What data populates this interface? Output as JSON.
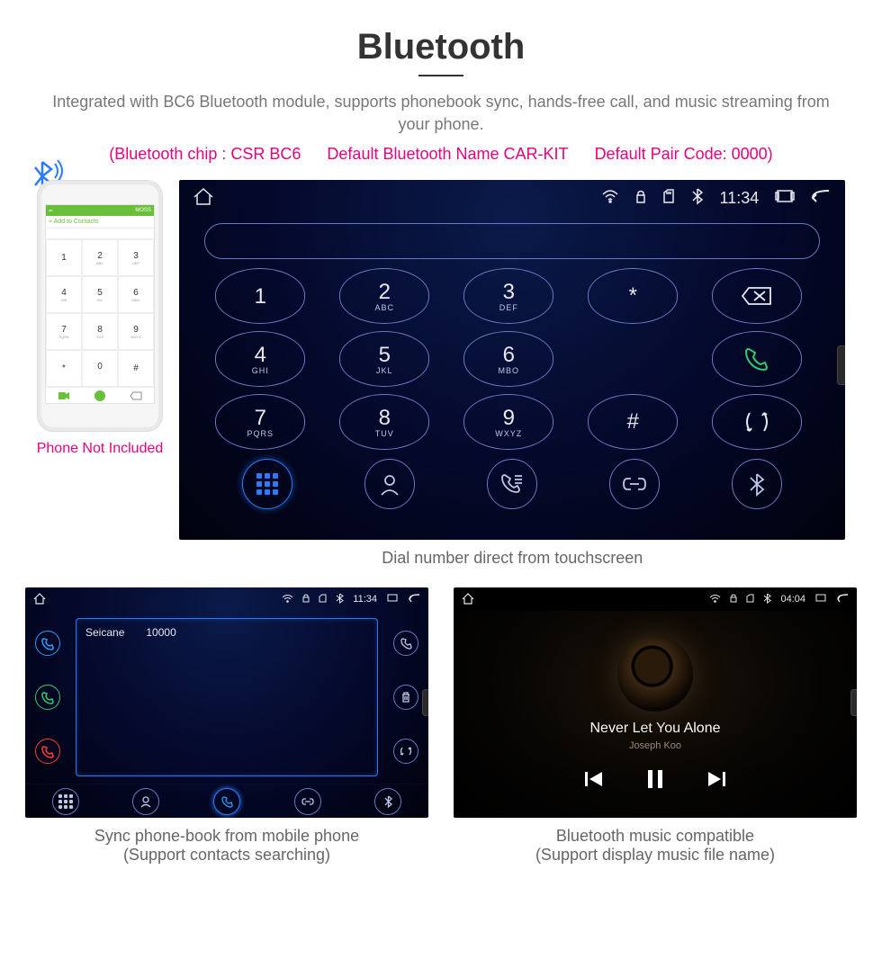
{
  "header": {
    "title": "Bluetooth"
  },
  "description": "Integrated with BC6 Bluetooth module, supports phonebook sync, hands-free call, and music streaming from your phone.",
  "specs": {
    "chip": "(Bluetooth chip : CSR BC6",
    "name": "Default Bluetooth Name CAR-KIT",
    "code": "Default Pair Code: 0000)"
  },
  "phone_mock": {
    "top_label": "MOSS",
    "add_label": "+ Add to Contacts",
    "caption": "Phone Not Included",
    "keys": [
      "1",
      "2",
      "3",
      "4",
      "5",
      "6",
      "7",
      "8",
      "9",
      "*",
      "0",
      "#"
    ]
  },
  "dialer": {
    "status_time": "11:34",
    "keys": [
      {
        "d": "1",
        "s": ""
      },
      {
        "d": "2",
        "s": "ABC"
      },
      {
        "d": "3",
        "s": "DEF"
      },
      {
        "d": "*",
        "s": ""
      },
      {
        "d": "DEL",
        "s": ""
      },
      {
        "d": "4",
        "s": "GHI"
      },
      {
        "d": "5",
        "s": "JKL"
      },
      {
        "d": "6",
        "s": "MBO"
      },
      {
        "d": "",
        "s": ""
      },
      {
        "d": "CALL",
        "s": ""
      },
      {
        "d": "7",
        "s": "PQRS"
      },
      {
        "d": "8",
        "s": "TUV"
      },
      {
        "d": "9",
        "s": "WXYZ"
      },
      {
        "d": "#",
        "s": ""
      },
      {
        "d": "SWAP",
        "s": ""
      }
    ],
    "caption": "Dial number direct from touchscreen"
  },
  "phonebook": {
    "status_time": "11:34",
    "contact_name": "Seicane",
    "contact_number": "10000",
    "caption_l1": "Sync phone-book from mobile phone",
    "caption_l2": "(Support contacts searching)"
  },
  "music": {
    "status_time": "04:04",
    "title": "Never Let You Alone",
    "artist": "Joseph Koo",
    "caption_l1": "Bluetooth music compatible",
    "caption_l2": "(Support display music file name)"
  }
}
